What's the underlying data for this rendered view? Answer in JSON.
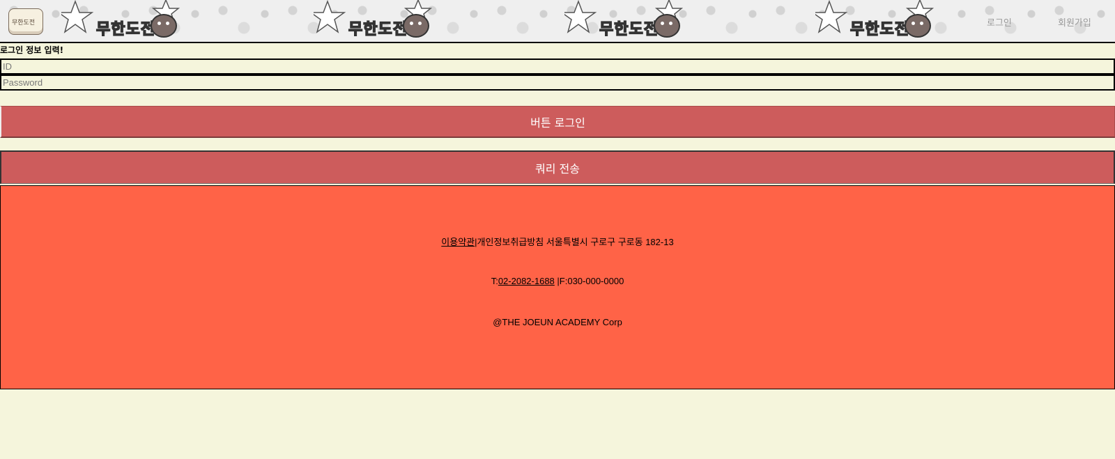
{
  "header": {
    "logo_text": "무한도전",
    "banner_text": "무한도전",
    "nav": {
      "login": "로그인",
      "signup": "회원가입"
    }
  },
  "form": {
    "title": "로그인 정보 입력!",
    "id_placeholder": "ID",
    "password_placeholder": "Password",
    "login_button": "버튼 로그인",
    "query_button": "쿼리 전송"
  },
  "footer": {
    "terms": "이용약관",
    "privacy_address": "|개인정보취급방침 서울특별시 구로구 구로동 182-13",
    "tel_prefix": "T:",
    "tel_number": "02-2082-1688",
    "fax": " |F:030-000-0000",
    "copyright": "@THE JOEUN ACADEMY Corp"
  },
  "colors": {
    "page_bg": "#f5f5dc",
    "button_bg": "#cd5c5c",
    "footer_bg": "#ff6347"
  }
}
